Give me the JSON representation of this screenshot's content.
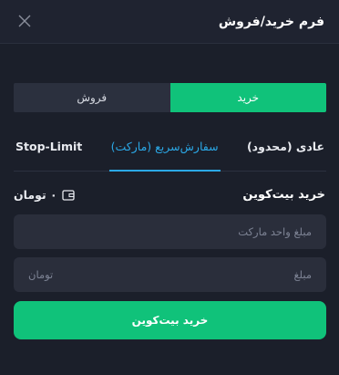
{
  "header": {
    "title": "فرم خرید/فروش",
    "close_icon": "close-icon"
  },
  "side_tabs": {
    "buy": "خرید",
    "sell": "فروش",
    "active": "buy"
  },
  "order_tabs": {
    "items": [
      {
        "label": "عادی (محدود)"
      },
      {
        "label": "سفارش‌سریع (مارکت)"
      },
      {
        "label": "Stop-Limit"
      }
    ],
    "active_index": 1
  },
  "buy_section": {
    "label": "خرید بیت‌کوین",
    "balance": "۰ تومان",
    "balance_icon": "wallet-icon"
  },
  "fields": {
    "market_amount_placeholder": "مبلغ واحد مارکت",
    "amount_label": "مبلغ",
    "amount_unit": "تومان"
  },
  "submit": {
    "label": "خرید بیت‌کوین"
  },
  "colors": {
    "accent": "#10c27a",
    "active_tab": "#2ba8e6",
    "background": "#1b1f2a"
  }
}
